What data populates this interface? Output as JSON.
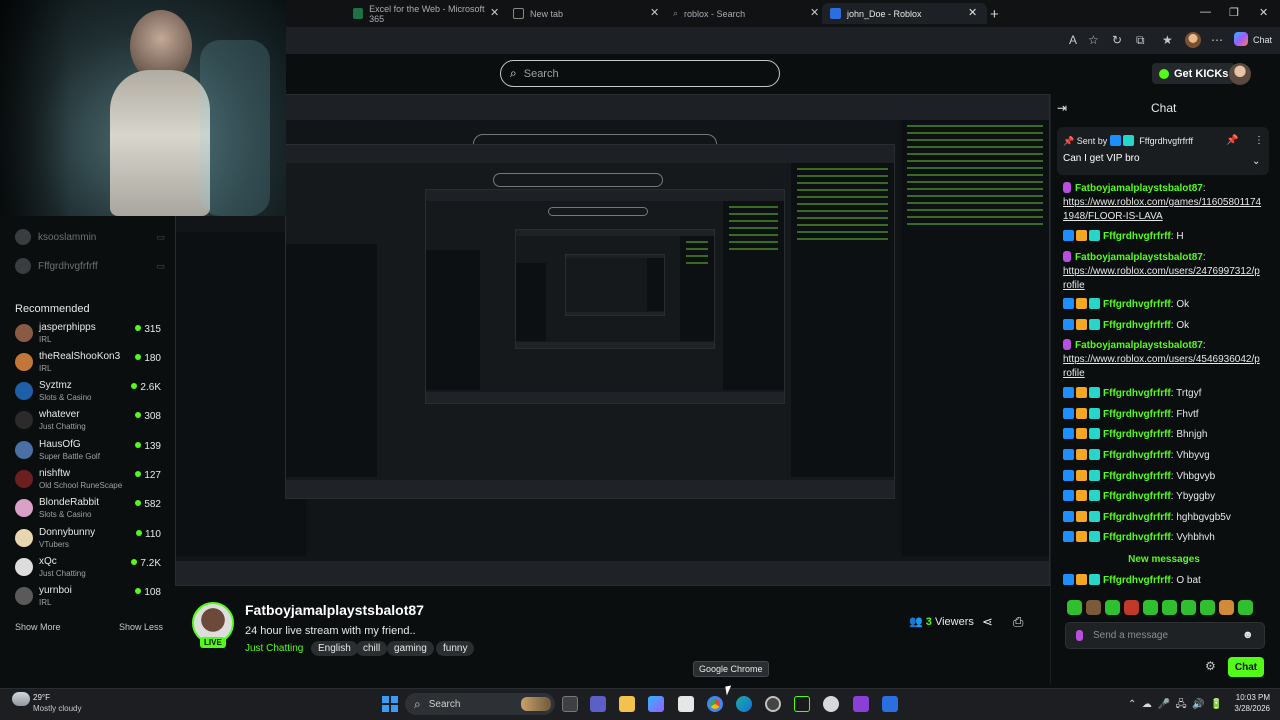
{
  "browser": {
    "tabs": [
      {
        "title": "Excel for the Web - Microsoft 365",
        "icon": "excel-icon",
        "active": false
      },
      {
        "title": "New tab",
        "icon": "newtab-icon",
        "active": false
      },
      {
        "title": "roblox - Search",
        "icon": "search-icon",
        "active": false
      },
      {
        "title": "john_Doe - Roblox",
        "icon": "roblox-icon",
        "active": true
      }
    ],
    "copilot_label": "Chat"
  },
  "header": {
    "search_placeholder": "Search",
    "get_kicks_label": "Get KICKs"
  },
  "sidebar": {
    "followed": [
      {
        "name": "ksooslammin"
      },
      {
        "name": "Fffgrdhvgfrfrff"
      }
    ],
    "recommended_title": "Recommended",
    "recommended": [
      {
        "name": "jasperphipps",
        "category": "IRL",
        "viewers": "315",
        "avatar_color": "#8a5a44"
      },
      {
        "name": "theRealShooKon3",
        "category": "IRL",
        "viewers": "180",
        "avatar_color": "#c2763a"
      },
      {
        "name": "Syztmz",
        "category": "Slots & Casino",
        "viewers": "2.6K",
        "avatar_color": "#1f5fa8"
      },
      {
        "name": "whatever",
        "category": "Just Chatting",
        "viewers": "308",
        "avatar_color": "#2b2b2b"
      },
      {
        "name": "HausOfG",
        "category": "Super Battle Golf",
        "viewers": "139",
        "avatar_color": "#4a6fa5"
      },
      {
        "name": "nishftw",
        "category": "Old School RuneScape",
        "viewers": "127",
        "avatar_color": "#6b1f1f"
      },
      {
        "name": "BlondeRabbit",
        "category": "Slots & Casino",
        "viewers": "582",
        "avatar_color": "#d9a0c8"
      },
      {
        "name": "Donnybunny",
        "category": "VTubers",
        "viewers": "110",
        "avatar_color": "#e8d6b0"
      },
      {
        "name": "xQc",
        "category": "Just Chatting",
        "viewers": "7.2K",
        "avatar_color": "#dddddd"
      },
      {
        "name": "yurnboi",
        "category": "IRL",
        "viewers": "108",
        "avatar_color": "#5a5a5a"
      }
    ],
    "show_more": "Show More",
    "show_less": "Show Less"
  },
  "stream": {
    "streamer": "Fatboyjamalplaystsbalot87",
    "live_badge": "LIVE",
    "title": "24 hour live stream with my friend..",
    "category": "Just Chatting",
    "tags": [
      "English",
      "chill",
      "gaming",
      "funny"
    ],
    "viewers_count": "3",
    "viewers_label": "Viewers"
  },
  "chat": {
    "title": "Chat",
    "pinned": {
      "sent_by_label": "Sent by",
      "sender": "Fffgrdhvgfrfrff",
      "message": "Can I get VIP bro"
    },
    "messages": [
      {
        "user": "Fatboyjamalplaystsbalot87",
        "text": "https://www.roblox.com/games/116058011741948/FLOOR-IS-LAVA",
        "type": "streamer",
        "link": true
      },
      {
        "user": "Fffgrdhvgfrfrff",
        "text": "H",
        "type": "viewer"
      },
      {
        "user": "Fatboyjamalplaystsbalot87",
        "text": "https://www.roblox.com/users/2476997312/profile",
        "type": "streamer",
        "link": true
      },
      {
        "user": "Fffgrdhvgfrfrff",
        "text": "Ok",
        "type": "viewer"
      },
      {
        "user": "Fffgrdhvgfrfrff",
        "text": "Ok",
        "type": "viewer"
      },
      {
        "user": "Fatboyjamalplaystsbalot87",
        "text": "https://www.roblox.com/users/4546936042/profile",
        "type": "streamer",
        "link": true
      },
      {
        "user": "Fffgrdhvgfrfrff",
        "text": "Trtgyf",
        "type": "viewer"
      },
      {
        "user": "Fffgrdhvgfrfrff",
        "text": "Fhvtf",
        "type": "viewer"
      },
      {
        "user": "Fffgrdhvgfrfrff",
        "text": "Bhnjgh",
        "type": "viewer"
      },
      {
        "user": "Fffgrdhvgfrfrff",
        "text": "Vhbyvg",
        "type": "viewer"
      },
      {
        "user": "Fffgrdhvgfrfrff",
        "text": "Vhbgvyb",
        "type": "viewer"
      },
      {
        "user": "Fffgrdhvgfrfrff",
        "text": "Ybyggby",
        "type": "viewer"
      },
      {
        "user": "Fffgrdhvgfrfrff",
        "text": "hghbgvgb5v",
        "type": "viewer"
      },
      {
        "user": "Fffgrdhvgfrfrff",
        "text": "Vyhbhvh",
        "type": "viewer"
      }
    ],
    "new_messages_label": "New messages",
    "latest": {
      "user": "Fffgrdhvgfrfrff",
      "text": "O bat"
    },
    "input_placeholder": "Send a message",
    "send_label": "Chat"
  },
  "tooltip": "Google Chrome",
  "taskbar": {
    "weather_temp": "29°F",
    "weather_condition": "Mostly cloudy",
    "search_label": "Search",
    "time": "10:03 PM",
    "date": "3/28/2026"
  },
  "colors": {
    "kick_green": "#53fc18",
    "background": "#0b0e0f",
    "badge_blue": "#1d8fff",
    "badge_gold": "#f5a623"
  }
}
